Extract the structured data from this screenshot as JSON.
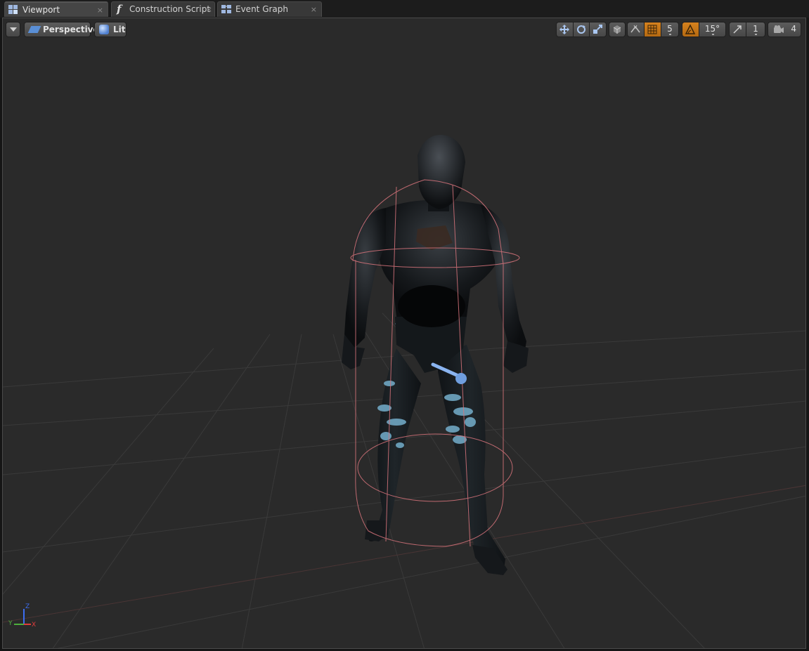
{
  "tabs": [
    {
      "label": "Viewport",
      "icon": "viewport-icon",
      "active": true,
      "close": "×"
    },
    {
      "label": "Construction Script",
      "icon": "function-icon",
      "active": false,
      "close": "×"
    },
    {
      "label": "Event Graph",
      "icon": "graph-icon",
      "active": false,
      "close": "×"
    }
  ],
  "toolbar": {
    "perspective_label": "Perspective",
    "lit_label": "Lit",
    "grid_snap_value": "5",
    "rotation_snap_value": "15°",
    "scale_snap_value": "1",
    "camera_speed_value": "4"
  },
  "axis": {
    "z": "Z",
    "y": "Y",
    "x": "X"
  },
  "colors": {
    "accent_orange": "#c97717",
    "capsule": "#d8747c",
    "arrow": "#8ab4f0"
  }
}
